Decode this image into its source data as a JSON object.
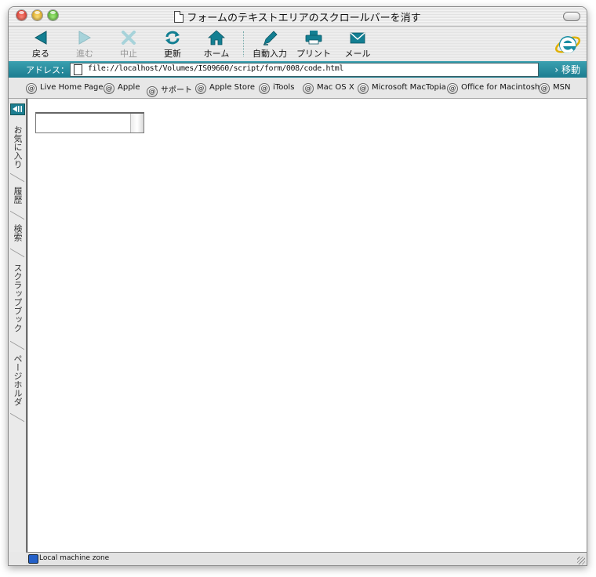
{
  "window": {
    "title": "フォームのテキストエリアのスクロールバーを消す"
  },
  "toolbar": {
    "back": "戻る",
    "forward": "進む",
    "stop": "中止",
    "refresh": "更新",
    "home": "ホーム",
    "autofill": "自動入力",
    "print": "プリント",
    "mail": "メール"
  },
  "address": {
    "label": "アドレス：",
    "url": "file://localhost/Volumes/IS09660/script/form/008/code.html",
    "go": "移動"
  },
  "favorites": [
    "Live Home Page",
    "Apple",
    "サポート",
    "Apple Store",
    "iTools",
    "Mac OS X",
    "Microsoft MacTopia",
    "Office for Macintosh",
    "MSN"
  ],
  "sidebar": {
    "tabs": [
      "お気に入り",
      "履歴",
      "検索",
      "スクラップブック",
      "ページホルダ"
    ]
  },
  "status": {
    "zone": "Local machine zone"
  },
  "colors": {
    "accent": "#1c7d90",
    "icon_teal": "#137f92"
  }
}
